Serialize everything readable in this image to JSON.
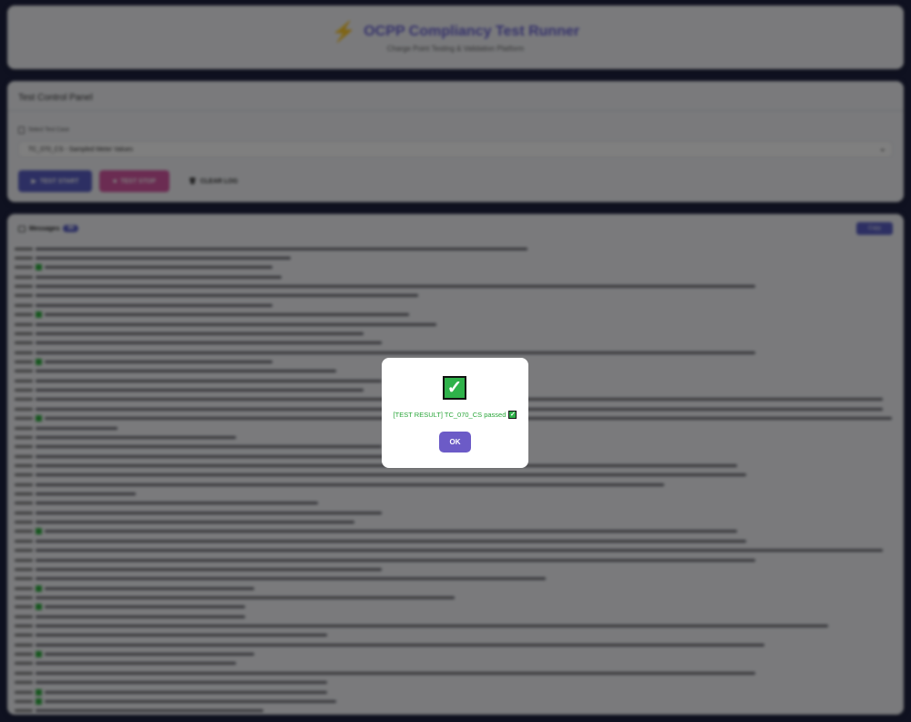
{
  "header": {
    "title": "OCPP Compliancy Test Runner",
    "subtitle": "Charge Point Testing & Validation Platform"
  },
  "control_panel": {
    "title": "Test Control Panel",
    "select_label": "Select Test Case",
    "selected_test": "TC_070_CS - Sampled Meter Values",
    "start_label": "TEST START",
    "stop_label": "TEST STOP",
    "clear_label": "CLEAR LOG"
  },
  "messages": {
    "title": "Messages",
    "count": "99",
    "copy_label": "Copy"
  },
  "dialog": {
    "message": "[TEST RESULT] TC_070_CS passed",
    "ok_label": "OK",
    "status_color": "#2fb24a"
  }
}
